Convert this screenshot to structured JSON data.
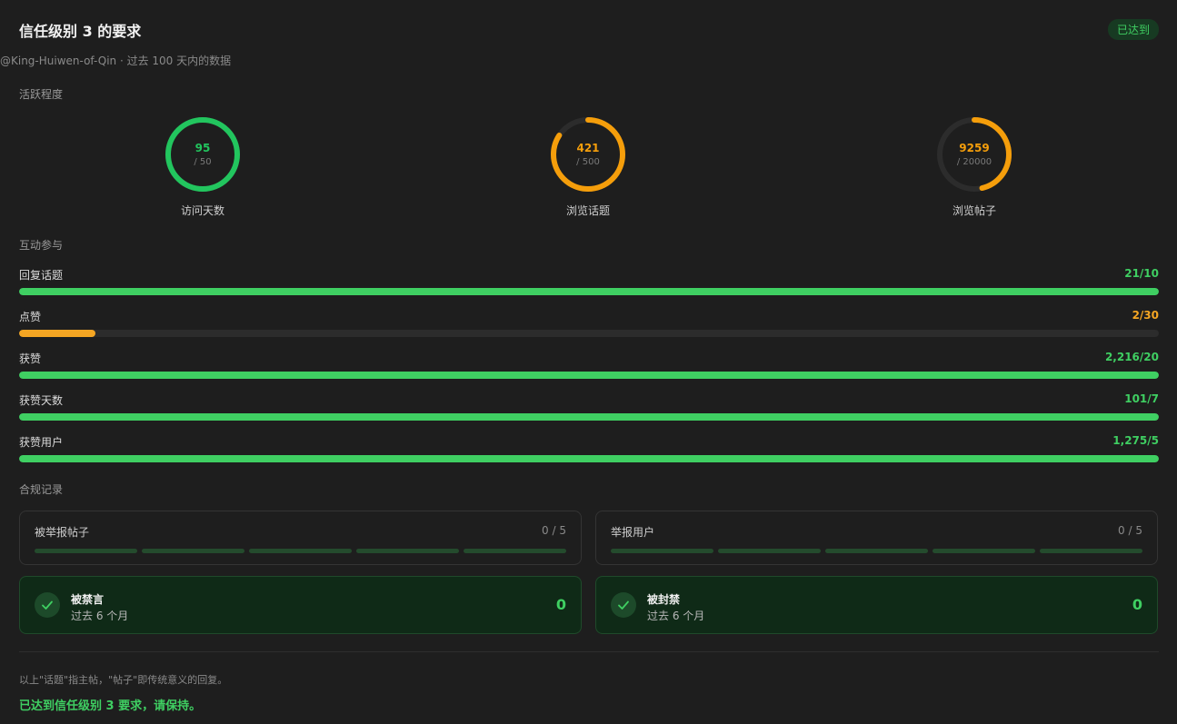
{
  "header": {
    "title": "信任级别 3 的要求",
    "badge": "已达到",
    "subtitle": "@King-Huiwen-of-Qin · 过去 100 天内的数据"
  },
  "activity": {
    "label": "活跃程度",
    "rings": [
      {
        "value": "95",
        "target": "/ 50",
        "label": "访问天数",
        "progress": 1.0,
        "color": "#22c55e"
      },
      {
        "value": "421",
        "target": "/ 500",
        "label": "浏览话题",
        "progress": 0.842,
        "color": "#f59e0b"
      },
      {
        "value": "9259",
        "target": "/ 20000",
        "label": "浏览帖子",
        "progress": 0.463,
        "color": "#f59e0b"
      }
    ]
  },
  "interaction": {
    "label": "互动参与",
    "bars": [
      {
        "label": "回复话题",
        "value": "21/10",
        "progress": 1.0,
        "color": "#3fcf62"
      },
      {
        "label": "点赞",
        "value": "2/30",
        "progress": 0.0667,
        "color": "#f5a623"
      },
      {
        "label": "获赞",
        "value": "2,216/20",
        "progress": 1.0,
        "color": "#3fcf62"
      },
      {
        "label": "获赞天数",
        "value": "101/7",
        "progress": 1.0,
        "color": "#3fcf62"
      },
      {
        "label": "获赞用户",
        "value": "1,275/5",
        "progress": 1.0,
        "color": "#3fcf62"
      }
    ]
  },
  "compliance": {
    "label": "合规记录",
    "reports": [
      {
        "label": "被举报帖子",
        "value": "0 / 5"
      },
      {
        "label": "举报用户",
        "value": "0 / 5"
      }
    ],
    "statuses": [
      {
        "title": "被禁言",
        "subtitle": "过去 6 个月",
        "count": "0"
      },
      {
        "title": "被封禁",
        "subtitle": "过去 6 个月",
        "count": "0"
      }
    ]
  },
  "footer": {
    "note": "以上\"话题\"指主帖，\"帖子\"即传统意义的回复。",
    "status": "已达到信任级别 3 要求，请保持。"
  },
  "colors": {
    "success": "#3fcf62",
    "warning": "#f59e0b",
    "background": "#1e1e1e"
  }
}
